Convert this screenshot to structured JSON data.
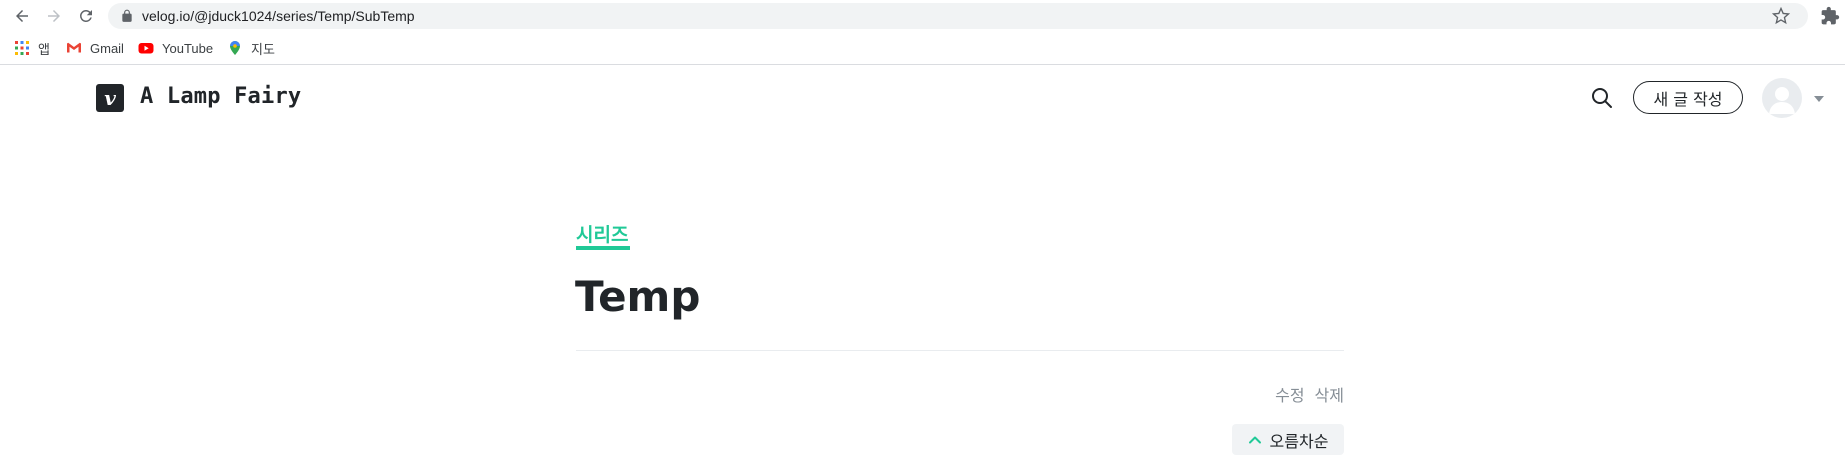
{
  "browser": {
    "url": "velog.io/@jduck1024/series/Temp/SubTemp",
    "bookmarks": [
      {
        "label": "앱",
        "icon": "apps-grid-icon"
      },
      {
        "label": "Gmail",
        "icon": "gmail-icon"
      },
      {
        "label": "YouTube",
        "icon": "youtube-icon"
      },
      {
        "label": "지도",
        "icon": "maps-pin-icon"
      }
    ]
  },
  "header": {
    "logo_letter": "v",
    "blog_title": "A Lamp Fairy",
    "write_label": "새 글 작성"
  },
  "series": {
    "tag": "시리즈",
    "title": "Temp",
    "edit_label": "수정",
    "delete_label": "삭제",
    "sort_label": "오름차순"
  },
  "colors": {
    "accent": "#20c997",
    "text": "#212529",
    "muted": "#868e96"
  }
}
